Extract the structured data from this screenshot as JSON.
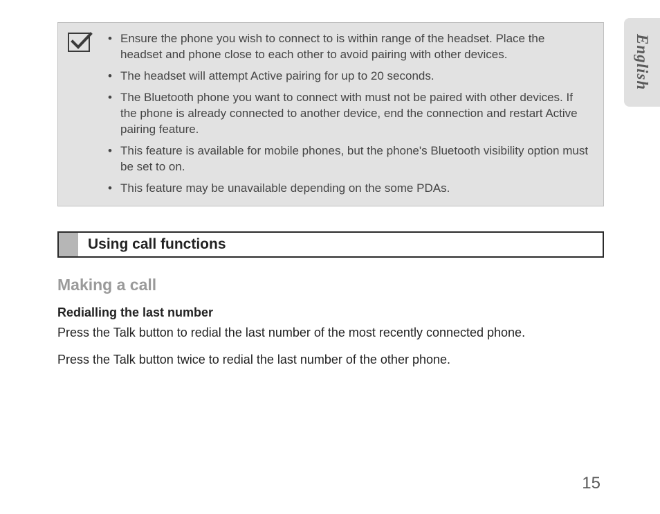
{
  "side_tab": "English",
  "note": {
    "items": [
      "Ensure the phone you wish to connect to is within range of the headset. Place the headset and phone close to each other to avoid pairing with other devices.",
      "The headset will attempt Active pairing for up to 20 seconds.",
      "The Bluetooth phone you want to connect with must not be paired with other devices. If the phone is already connected to another device, end the connection and restart Active pairing feature.",
      "This feature is available for mobile phones, but the phone's Bluetooth visibility option must be set to on.",
      "This feature may be unavailable depending on the some PDAs."
    ]
  },
  "section": {
    "title": "Using call functions"
  },
  "subsection": {
    "title": "Making a call",
    "subheading": "Redialling the last number",
    "paragraphs": [
      "Press the Talk button to redial the last number of the most recently connected phone.",
      "Press the Talk button twice to redial the last number of the other phone."
    ]
  },
  "page_number": "15"
}
